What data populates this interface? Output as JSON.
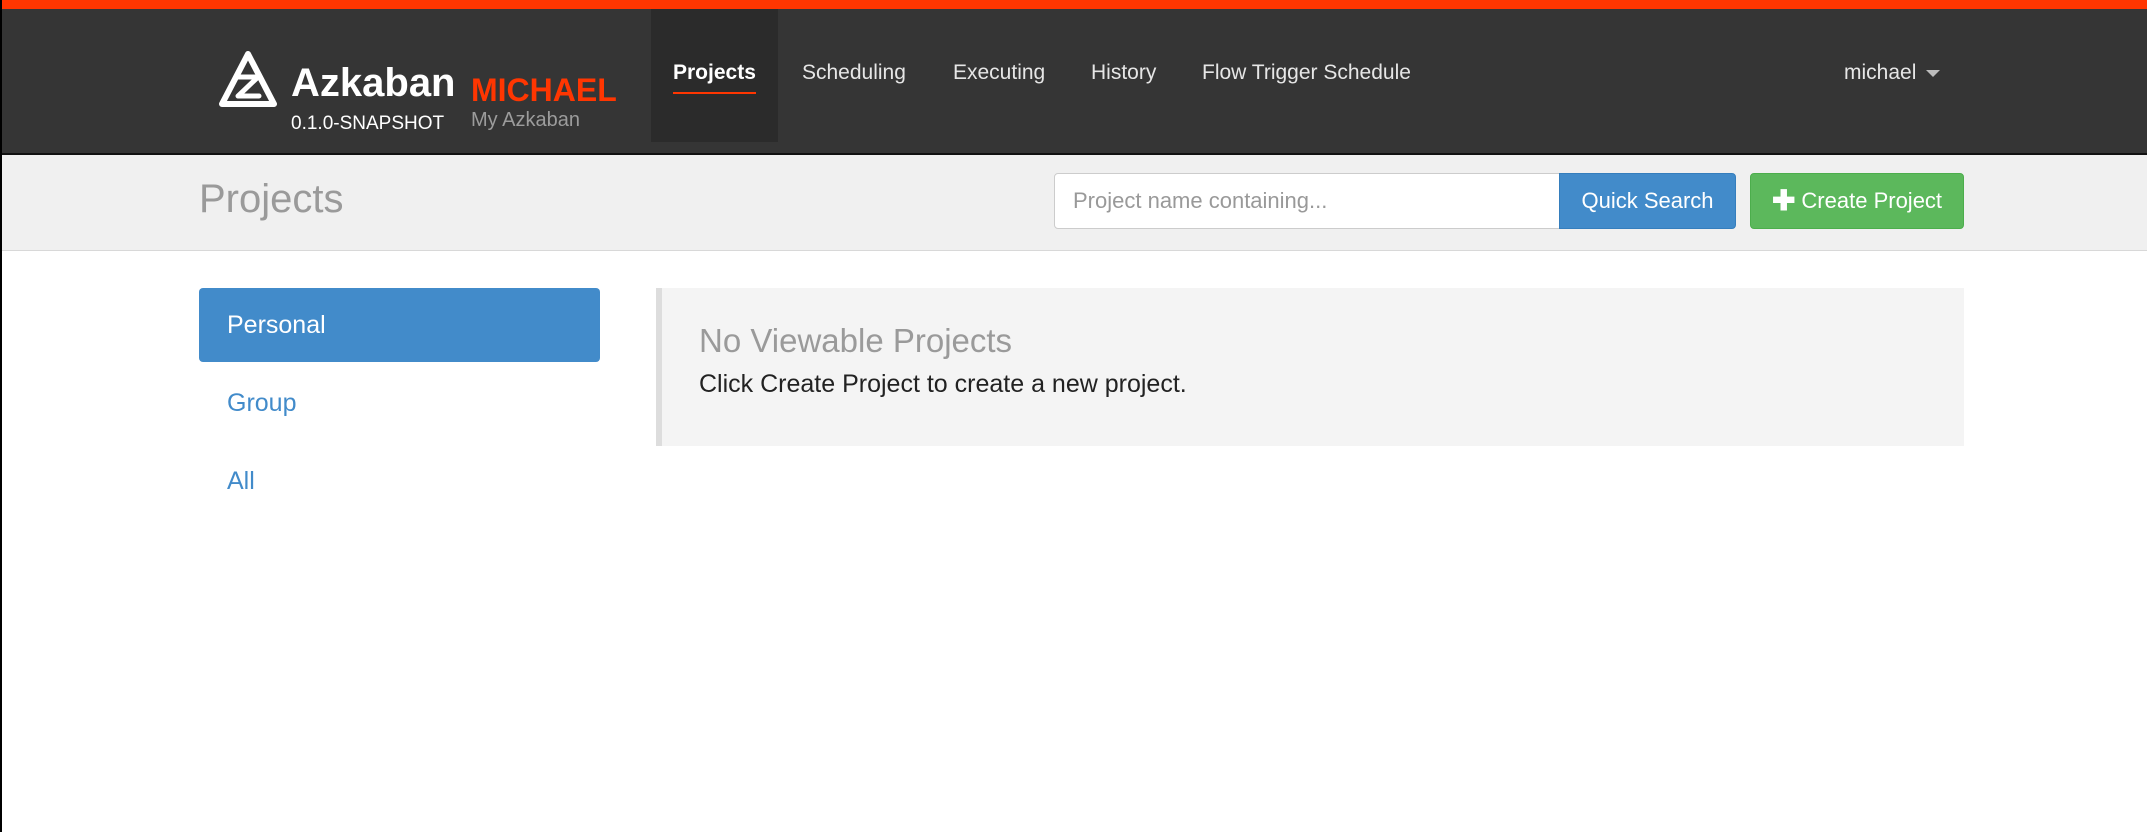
{
  "brand": {
    "name": "Azkaban",
    "environment": "MICHAEL",
    "version": "0.1.0-SNAPSHOT",
    "subtitle": "My Azkaban",
    "logo_icon": "azkaban-logo-icon"
  },
  "colors": {
    "accent": "#ff3601",
    "navbar": "#353535",
    "primary": "#428bca",
    "success": "#5cb85c"
  },
  "nav": {
    "items": [
      {
        "label": "Projects",
        "active": true
      },
      {
        "label": "Scheduling",
        "active": false
      },
      {
        "label": "Executing",
        "active": false
      },
      {
        "label": "History",
        "active": false
      },
      {
        "label": "Flow Trigger Schedule",
        "active": false
      }
    ],
    "user": "michael"
  },
  "header": {
    "title": "Projects",
    "search_placeholder": "Project name containing...",
    "search_value": "",
    "quick_search_label": "Quick Search",
    "create_project_label": "Create Project",
    "create_project_icon": "plus-icon"
  },
  "sidebar": {
    "items": [
      {
        "label": "Personal",
        "active": true
      },
      {
        "label": "Group",
        "active": false
      },
      {
        "label": "All",
        "active": false
      }
    ]
  },
  "main": {
    "empty_title": "No Viewable Projects",
    "empty_message": "Click Create Project to create a new project."
  }
}
